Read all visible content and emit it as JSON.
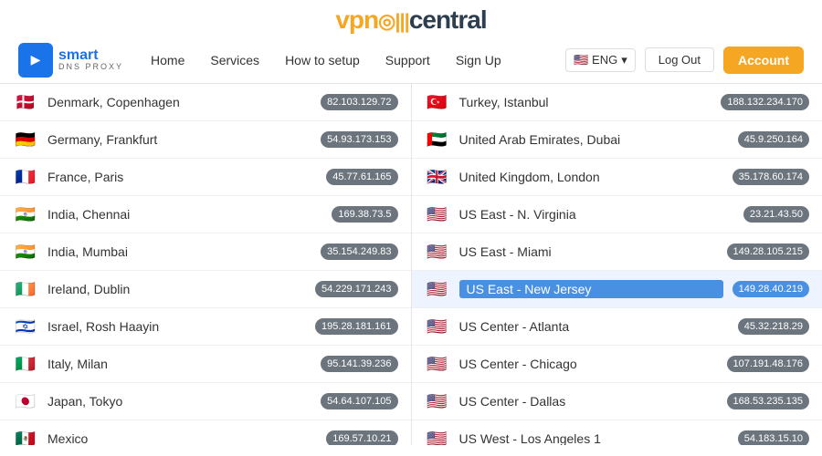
{
  "logo": {
    "vpn": "vpn",
    "central": "central"
  },
  "nav": {
    "home": "Home",
    "services": "Services",
    "how_to_setup": "How to setup",
    "support": "Support",
    "sign_up": "Sign Up",
    "lang": "🇺🇸 ENG",
    "logout": "Log Out",
    "account": "Account"
  },
  "left_servers": [
    {
      "flag": "🇩🇰",
      "name": "Denmark, Copenhagen",
      "ip": "82.103.129.72"
    },
    {
      "flag": "🇩🇪",
      "name": "Germany, Frankfurt",
      "ip": "54.93.173.153"
    },
    {
      "flag": "🇫🇷",
      "name": "France, Paris",
      "ip": "45.77.61.165"
    },
    {
      "flag": "🇮🇳",
      "name": "India, Chennai",
      "ip": "169.38.73.5"
    },
    {
      "flag": "🇮🇳",
      "name": "India, Mumbai",
      "ip": "35.154.249.83"
    },
    {
      "flag": "🇮🇪",
      "name": "Ireland, Dublin",
      "ip": "54.229.171.243"
    },
    {
      "flag": "🇮🇱",
      "name": "Israel, Rosh Haayin",
      "ip": "195.28.181.161"
    },
    {
      "flag": "🇮🇹",
      "name": "Italy, Milan",
      "ip": "95.141.39.236"
    },
    {
      "flag": "🇯🇵",
      "name": "Japan, Tokyo",
      "ip": "54.64.107.105"
    },
    {
      "flag": "🇲🇽",
      "name": "Mexico",
      "ip": "169.57.10.21"
    }
  ],
  "right_servers": [
    {
      "flag": "🇹🇷",
      "name": "Turkey, Istanbul",
      "ip": "188.132.234.170"
    },
    {
      "flag": "🇦🇪",
      "name": "United Arab Emirates, Dubai",
      "ip": "45.9.250.164"
    },
    {
      "flag": "🇬🇧",
      "name": "United Kingdom, London",
      "ip": "35.178.60.174"
    },
    {
      "flag": "🇺🇸",
      "name": "US East - N. Virginia",
      "ip": "23.21.43.50"
    },
    {
      "flag": "🇺🇸",
      "name": "US East - Miami",
      "ip": "149.28.105.215"
    },
    {
      "flag": "🇺🇸",
      "name": "US East - New Jersey",
      "ip": "149.28.40.219",
      "highlight": true
    },
    {
      "flag": "🇺🇸",
      "name": "US Center - Atlanta",
      "ip": "45.32.218.29"
    },
    {
      "flag": "🇺🇸",
      "name": "US Center - Chicago",
      "ip": "107.191.48.176"
    },
    {
      "flag": "🇺🇸",
      "name": "US Center - Dallas",
      "ip": "168.53.235.135"
    },
    {
      "flag": "🇺🇸",
      "name": "US West - Los Angeles 1",
      "ip": "54.183.15.10"
    }
  ]
}
